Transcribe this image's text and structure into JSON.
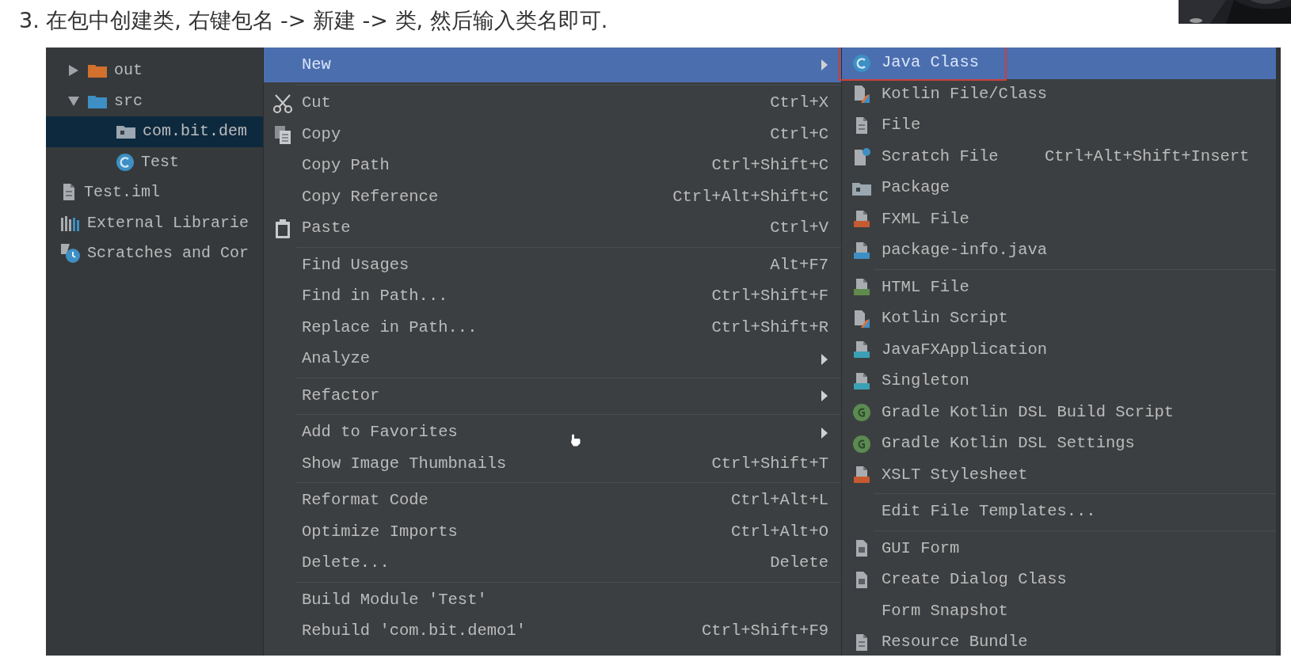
{
  "heading": "3. 在包中创建类, 右键包名 -> 新建 -> 类, 然后输入类名即可.",
  "thumbnail": {
    "kind": "picture"
  },
  "project_tree": [
    {
      "label": "out",
      "kind": "excluded-folder",
      "expanded": false,
      "selected": false
    },
    {
      "label": "src",
      "kind": "source-folder",
      "expanded": true,
      "selected": false,
      "children": [
        {
          "label": "com.bit.dem",
          "kind": "package",
          "selected": true
        },
        {
          "label": "Test",
          "kind": "java-class",
          "selected": false
        }
      ]
    },
    {
      "label": "Test.iml",
      "kind": "iml-file",
      "selected": false
    },
    {
      "label": "External Librarie",
      "kind": "libraries",
      "selected": false
    },
    {
      "label": "Scratches and Cor",
      "kind": "scratches",
      "selected": false
    }
  ],
  "context_menu": [
    [
      {
        "label": "New",
        "submenu": true,
        "selected": true
      }
    ],
    [
      {
        "label": "Cut",
        "kind": "cut",
        "shortcut": "Ctrl+X",
        "selected": false
      },
      {
        "label": "Copy",
        "kind": "copy",
        "shortcut": "Ctrl+C",
        "selected": false
      },
      {
        "label": "Copy Path",
        "shortcut": "Ctrl+Shift+C",
        "selected": false
      },
      {
        "label": "Copy Reference",
        "shortcut": "Ctrl+Alt+Shift+C",
        "selected": false
      },
      {
        "label": "Paste",
        "kind": "paste",
        "shortcut": "Ctrl+V",
        "selected": false
      }
    ],
    [
      {
        "label": "Find Usages",
        "shortcut": "Alt+F7",
        "selected": false
      },
      {
        "label": "Find in Path...",
        "shortcut": "Ctrl+Shift+F",
        "selected": false
      },
      {
        "label": "Replace in Path...",
        "shortcut": "Ctrl+Shift+R",
        "selected": false
      },
      {
        "label": "Analyze",
        "submenu": true,
        "selected": false
      }
    ],
    [
      {
        "label": "Refactor",
        "submenu": true,
        "selected": false
      }
    ],
    [
      {
        "label": "Add to Favorites",
        "submenu": true,
        "selected": false
      },
      {
        "label": "Show Image Thumbnails",
        "shortcut": "Ctrl+Shift+T",
        "selected": false
      }
    ],
    [
      {
        "label": "Reformat Code",
        "shortcut": "Ctrl+Alt+L",
        "selected": false
      },
      {
        "label": "Optimize Imports",
        "shortcut": "Ctrl+Alt+O",
        "selected": false
      },
      {
        "label": "Delete...",
        "shortcut": "Delete",
        "selected": false
      }
    ],
    [
      {
        "label": "Build Module 'Test'",
        "selected": false
      },
      {
        "label": "Rebuild 'com.bit.demo1'",
        "shortcut": "Ctrl+Shift+F9",
        "selected": false
      }
    ]
  ],
  "new_submenu": [
    [
      {
        "label": "Java Class",
        "kind": "java-class",
        "selected": true,
        "outlined": true
      },
      {
        "label": "Kotlin File/Class",
        "kind": "kotlin-file",
        "selected": false,
        "outlined": false
      },
      {
        "label": "File",
        "kind": "file",
        "selected": false,
        "outlined": false
      },
      {
        "label": "Scratch File",
        "kind": "scratch-file",
        "shortcut": "Ctrl+Alt+Shift+Insert",
        "selected": false,
        "outlined": false
      },
      {
        "label": "Package",
        "kind": "package",
        "selected": false,
        "outlined": false
      },
      {
        "label": "FXML File",
        "kind": "fxml-file",
        "selected": false,
        "outlined": false
      },
      {
        "label": "package-info.java",
        "kind": "java-file",
        "selected": false,
        "outlined": false
      }
    ],
    [
      {
        "label": "HTML File",
        "kind": "html-file",
        "selected": false,
        "outlined": false
      },
      {
        "label": "Kotlin Script",
        "kind": "kotlin-file",
        "selected": false,
        "outlined": false
      },
      {
        "label": "JavaFXApplication",
        "kind": "javafx-file",
        "selected": false,
        "outlined": false
      },
      {
        "label": "Singleton",
        "kind": "javafx-file",
        "selected": false,
        "outlined": false
      },
      {
        "label": "Gradle Kotlin DSL Build Script",
        "kind": "gradle",
        "selected": false,
        "outlined": false
      },
      {
        "label": "Gradle Kotlin DSL Settings",
        "kind": "gradle",
        "selected": false,
        "outlined": false
      },
      {
        "label": "XSLT Stylesheet",
        "kind": "fxml-file",
        "selected": false,
        "outlined": false
      }
    ],
    [
      {
        "label": "Edit File Templates...",
        "selected": false,
        "outlined": false
      }
    ],
    [
      {
        "label": "GUI Form",
        "kind": "form",
        "selected": false,
        "outlined": false
      },
      {
        "label": "Create Dialog Class",
        "kind": "form",
        "selected": false,
        "outlined": false
      },
      {
        "label": "Form Snapshot",
        "selected": false,
        "outlined": false
      },
      {
        "label": "Resource Bundle",
        "kind": "file",
        "selected": false,
        "outlined": false
      }
    ]
  ]
}
